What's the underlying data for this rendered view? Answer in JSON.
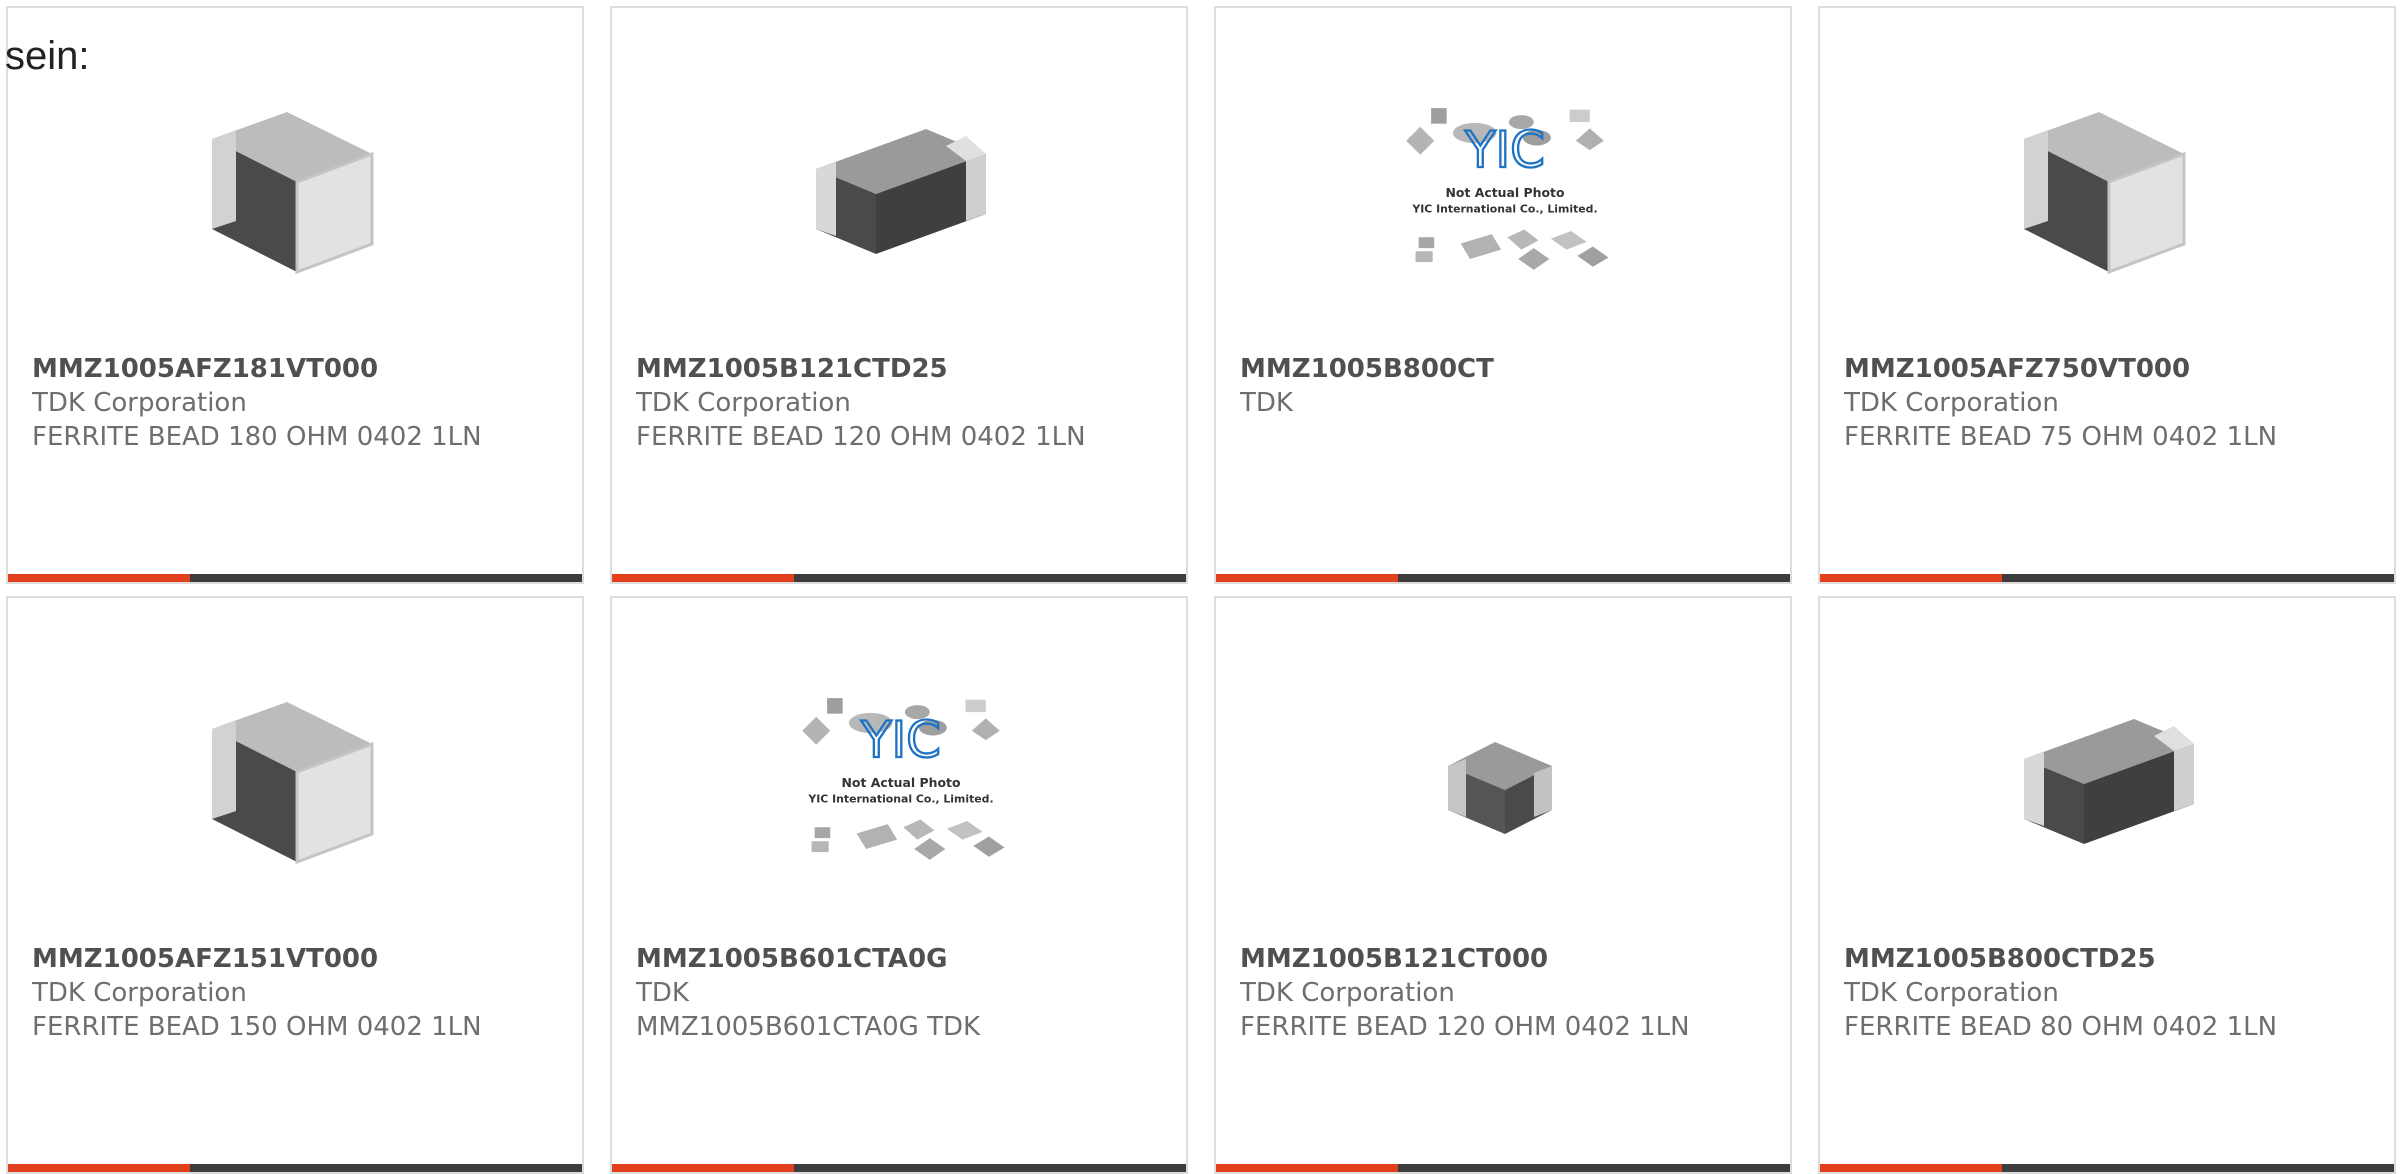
{
  "intro_text": "sein:",
  "colors": {
    "accent": "#e2401c",
    "bar_dark": "#3d3d3d",
    "chip_body": "#4a4a4a",
    "chip_cap": "#d8d8d8",
    "yic_blue": "#1f73c3"
  },
  "placeholder": {
    "line1": "Not Actual Photo",
    "line2": "YIC International Co., Limited."
  },
  "products": [
    {
      "part": "MMZ1005AFZ181VT000",
      "maker": "TDK Corporation",
      "desc": "FERRITE BEAD 180 OHM 0402 1LN",
      "image": "chip-angle"
    },
    {
      "part": "MMZ1005B121CTD25",
      "maker": "TDK Corporation",
      "desc": "FERRITE BEAD 120 OHM 0402 1LN",
      "image": "chip-side"
    },
    {
      "part": "MMZ1005B800CT",
      "maker": "TDK",
      "desc": "",
      "image": "yic-placeholder"
    },
    {
      "part": "MMZ1005AFZ750VT000",
      "maker": "TDK Corporation",
      "desc": "FERRITE BEAD 75 OHM 0402 1LN",
      "image": "chip-angle"
    },
    {
      "part": "MMZ1005AFZ151VT000",
      "maker": "TDK Corporation",
      "desc": "FERRITE BEAD 150 OHM 0402 1LN",
      "image": "chip-angle"
    },
    {
      "part": "MMZ1005B601CTA0G",
      "maker": "TDK",
      "desc": "MMZ1005B601CTA0G TDK",
      "image": "yic-placeholder"
    },
    {
      "part": "MMZ1005B121CT000",
      "maker": "TDK Corporation",
      "desc": "FERRITE BEAD 120 OHM 0402 1LN",
      "image": "chip-small"
    },
    {
      "part": "MMZ1005B800CTD25",
      "maker": "TDK Corporation",
      "desc": "FERRITE BEAD 80 OHM 0402 1LN",
      "image": "chip-side"
    }
  ]
}
